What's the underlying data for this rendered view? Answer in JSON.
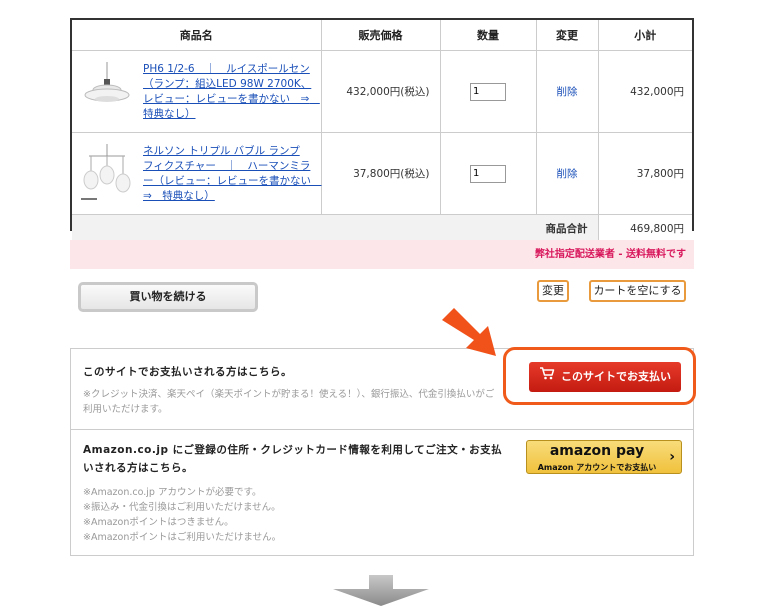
{
  "table": {
    "headers": [
      "商品名",
      "販売価格",
      "数量",
      "変更",
      "小計"
    ],
    "items": [
      {
        "name": "PH6 1/2-6　｜　ルイスポールセン（ランプ：組込LED 98W 2700K、レビュー：レビューを書かない　⇒　特典なし）",
        "price": "432,000円(税込)",
        "qty": "1",
        "delete": "削除",
        "subtotal": "432,000円"
      },
      {
        "name": "ネルソン トリプル バブル ランプ フィクスチャー　｜　ハーマンミラー（レビュー：レビューを書かない　⇒　特典なし）",
        "price": "37,800円(税込)",
        "qty": "1",
        "delete": "削除",
        "subtotal": "37,800円"
      }
    ],
    "total_label": "商品合計",
    "total_value": "469,800円"
  },
  "notice": "弊社指定配送業者 - 送料無料です",
  "buttons": {
    "continue": "買い物を続ける",
    "change": "変更",
    "empty": "カートを空にする"
  },
  "site_pay": {
    "heading": "このサイトでお支払いされる方はこちら。",
    "note_1": "※クレジット決済、楽天ペイ（楽天ポイントが貯まる！使える！）、銀行振込、代金引換払いがご",
    "note_2": "利用いただけます。",
    "button": "このサイトでお支払い"
  },
  "amazon_pay": {
    "heading_1": "Amazon.co.jp にご登録の住所・クレジットカード情報を利用してご注文・お支払",
    "heading_2": "いされる方はこちら。",
    "notes": [
      "※Amazon.co.jp アカウントが必要です。",
      "※振込み・代金引換はご利用いただけません。",
      "※Amazonポイントはつきません。",
      "※Amazonポイントはご利用いただけません。"
    ],
    "button_logo": "amazon pay",
    "button_sub": "Amazon アカウントでお支払い"
  },
  "colors": {
    "accent_red": "#c41b11",
    "highlight_orange": "#f05a1a",
    "notice_pink": "#d8185c",
    "amazon_yellow": "#f0c13c"
  }
}
